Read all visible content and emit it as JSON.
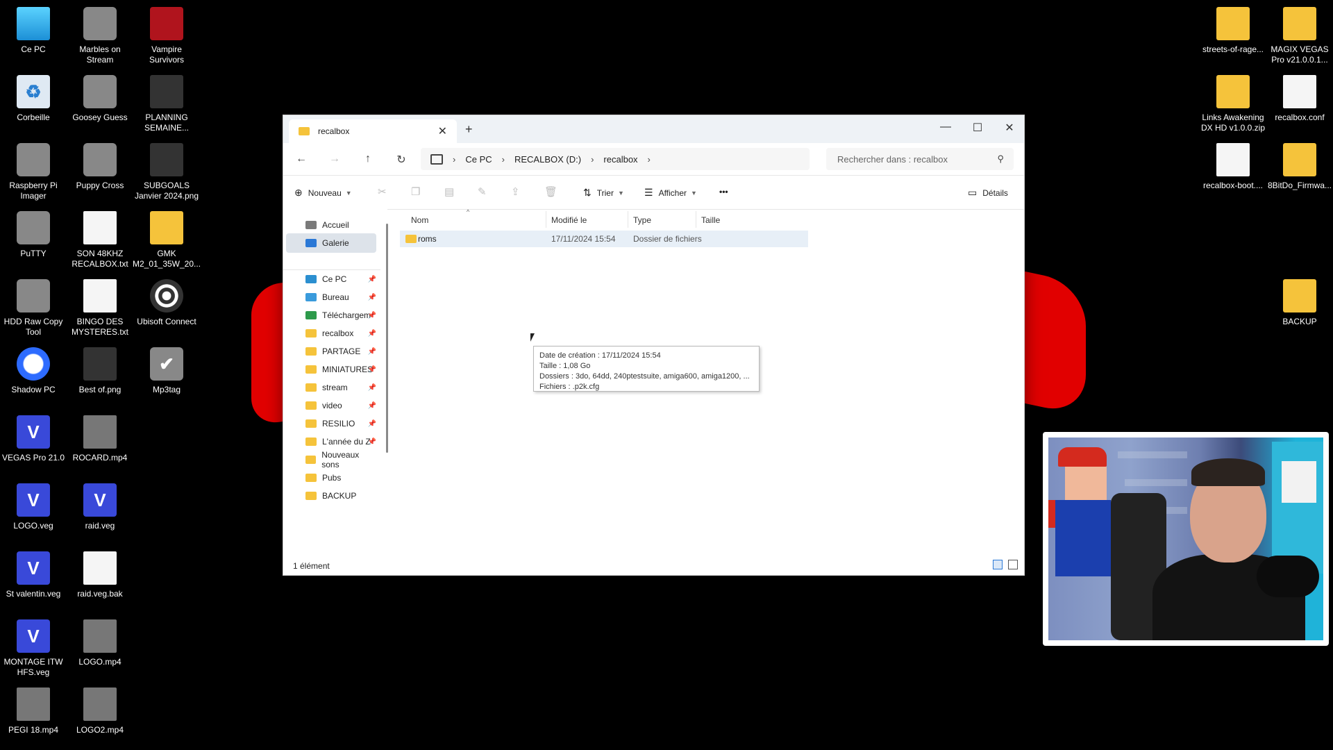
{
  "desktop": {
    "col1": [
      {
        "label": "Ce PC",
        "icon": "monitor-icon"
      },
      {
        "label": "Corbeille",
        "icon": "recycle-bin-icon"
      },
      {
        "label": "Raspberry Pi Imager",
        "icon": "raspberry-pi-icon"
      },
      {
        "label": "PuTTY",
        "icon": "putty-icon"
      },
      {
        "label": "HDD Raw Copy Tool",
        "icon": "hdd-tool-icon"
      },
      {
        "label": "Shadow PC",
        "icon": "shadow-pc-icon"
      },
      {
        "label": "VEGAS Pro 21.0",
        "icon": "vegas-icon"
      },
      {
        "label": "LOGO.veg",
        "icon": "veg-file-icon"
      },
      {
        "label": "St valentin.veg",
        "icon": "veg-file-icon"
      },
      {
        "label": "MONTAGE ITW HFS.veg",
        "icon": "veg-file-icon"
      },
      {
        "label": "PEGI 18.mp4",
        "icon": "video-file-icon"
      }
    ],
    "col2": [
      {
        "label": "Marbles on Stream",
        "icon": "marbles-icon"
      },
      {
        "label": "Goosey Guess",
        "icon": "goose-icon"
      },
      {
        "label": "Puppy Cross",
        "icon": "puppy-icon"
      },
      {
        "label": "SON 48KHZ RECALBOX.txt",
        "icon": "text-file-icon"
      },
      {
        "label": "BINGO DES MYSTERES.txt",
        "icon": "text-file-icon"
      },
      {
        "label": "Best of.png",
        "icon": "image-file-icon"
      },
      {
        "label": "ROCARD.mp4",
        "icon": "video-file-icon"
      },
      {
        "label": "raid.veg",
        "icon": "veg-file-icon"
      },
      {
        "label": "raid.veg.bak",
        "icon": "blank-file-icon"
      },
      {
        "label": "LOGO.mp4",
        "icon": "video-file-icon"
      },
      {
        "label": "LOGO2.mp4",
        "icon": "video-file-icon"
      }
    ],
    "col3": [
      {
        "label": "Vampire Survivors",
        "icon": "vampire-survivors-icon"
      },
      {
        "label": "PLANNING SEMAINE...",
        "icon": "image-file-icon"
      },
      {
        "label": "SUBGOALS Janvier 2024.png",
        "icon": "image-file-icon"
      },
      {
        "label": "GMK M2_01_35W_20...",
        "icon": "folder-icon"
      },
      {
        "label": "Ubisoft Connect",
        "icon": "ubisoft-icon"
      },
      {
        "label": "Mp3tag",
        "icon": "mp3tag-icon"
      }
    ],
    "right": [
      {
        "label": "streets-of-rage...",
        "icon": "zip-folder-icon"
      },
      {
        "label": "MAGIX VEGAS Pro v21.0.0.1...",
        "icon": "folder-icon"
      },
      {
        "label": "Links Awakening DX HD v1.0.0.zip",
        "icon": "zip-folder-icon"
      },
      {
        "label": "recalbox.conf",
        "icon": "text-file-icon"
      },
      {
        "label": "recalbox-boot....",
        "icon": "text-file-icon"
      },
      {
        "label": "8BitDo_Firmwa...",
        "icon": "folder-icon"
      },
      {
        "label": "BACKUP",
        "icon": "folder-icon"
      }
    ]
  },
  "explorer": {
    "tab_title": "recalbox",
    "new_tab": "+",
    "window_controls": {
      "minimize": "—",
      "maximize": "☐",
      "close": "✕"
    },
    "nav": {
      "back": "←",
      "forward": "→",
      "up": "↑",
      "refresh": "↻"
    },
    "breadcrumb": [
      "Ce PC",
      "RECALBOX (D:)",
      "recalbox"
    ],
    "breadcrumb_sep": "›",
    "search_placeholder": "Rechercher dans : recalbox",
    "toolbar": {
      "new": "Nouveau",
      "sort": "Trier",
      "view": "Afficher",
      "more": "•••",
      "details": "Détails"
    },
    "sidebar": [
      {
        "label": "Accueil",
        "pinned": false,
        "kind": "home"
      },
      {
        "label": "Galerie",
        "pinned": false,
        "kind": "gallery",
        "selected": true
      },
      {
        "label": "Ce PC",
        "pinned": true,
        "kind": "pc"
      },
      {
        "label": "Bureau",
        "pinned": true,
        "kind": "desktop"
      },
      {
        "label": "Téléchargem",
        "pinned": true,
        "kind": "download"
      },
      {
        "label": "recalbox",
        "pinned": true,
        "kind": "folder"
      },
      {
        "label": "PARTAGE",
        "pinned": true,
        "kind": "folder"
      },
      {
        "label": "MINIATURES",
        "pinned": true,
        "kind": "folder"
      },
      {
        "label": "stream",
        "pinned": true,
        "kind": "folder"
      },
      {
        "label": "video",
        "pinned": true,
        "kind": "folder"
      },
      {
        "label": "RESILIO",
        "pinned": true,
        "kind": "folder"
      },
      {
        "label": "L'année du Z",
        "pinned": true,
        "kind": "folder"
      },
      {
        "label": "Nouveaux sons",
        "pinned": false,
        "kind": "folder"
      },
      {
        "label": "Pubs",
        "pinned": false,
        "kind": "folder"
      },
      {
        "label": "BACKUP",
        "pinned": false,
        "kind": "folder"
      }
    ],
    "columns": {
      "name": "Nom",
      "modified": "Modifié le",
      "type": "Type",
      "size": "Taille"
    },
    "rows": [
      {
        "name": "roms",
        "modified": "17/11/2024 15:54",
        "type": "Dossier de fichiers",
        "size": ""
      }
    ],
    "tooltip": [
      "Date de création : 17/11/2024 15:54",
      "Taille : 1,08 Go",
      "Dossiers : 3do, 64dd, 240ptestsuite, amiga600, amiga1200, ...",
      "Fichiers : .p2k.cfg"
    ],
    "status": "1 élément"
  },
  "colors": {
    "accent": "#2a78d6",
    "folder": "#f5c33b",
    "swoosh": "#e10000"
  }
}
